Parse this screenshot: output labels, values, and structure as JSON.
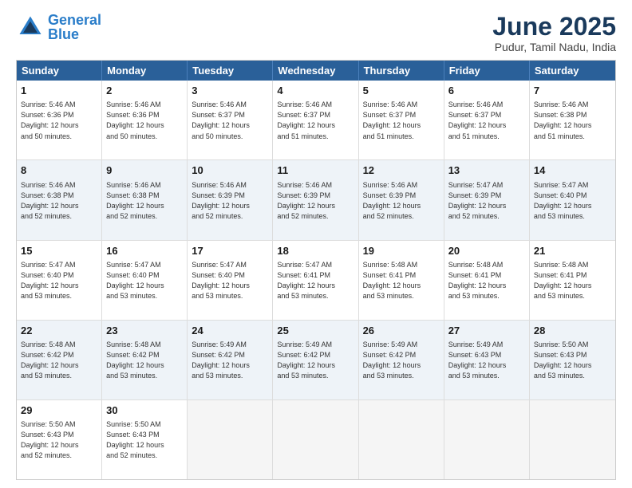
{
  "header": {
    "logo_general": "General",
    "logo_blue": "Blue",
    "month_title": "June 2025",
    "location": "Pudur, Tamil Nadu, India"
  },
  "calendar": {
    "days": [
      "Sunday",
      "Monday",
      "Tuesday",
      "Wednesday",
      "Thursday",
      "Friday",
      "Saturday"
    ],
    "rows": [
      [
        {
          "day": "1",
          "info": "Sunrise: 5:46 AM\nSunset: 6:36 PM\nDaylight: 12 hours\nand 50 minutes."
        },
        {
          "day": "2",
          "info": "Sunrise: 5:46 AM\nSunset: 6:36 PM\nDaylight: 12 hours\nand 50 minutes."
        },
        {
          "day": "3",
          "info": "Sunrise: 5:46 AM\nSunset: 6:37 PM\nDaylight: 12 hours\nand 50 minutes."
        },
        {
          "day": "4",
          "info": "Sunrise: 5:46 AM\nSunset: 6:37 PM\nDaylight: 12 hours\nand 51 minutes."
        },
        {
          "day": "5",
          "info": "Sunrise: 5:46 AM\nSunset: 6:37 PM\nDaylight: 12 hours\nand 51 minutes."
        },
        {
          "day": "6",
          "info": "Sunrise: 5:46 AM\nSunset: 6:37 PM\nDaylight: 12 hours\nand 51 minutes."
        },
        {
          "day": "7",
          "info": "Sunrise: 5:46 AM\nSunset: 6:38 PM\nDaylight: 12 hours\nand 51 minutes."
        }
      ],
      [
        {
          "day": "8",
          "info": "Sunrise: 5:46 AM\nSunset: 6:38 PM\nDaylight: 12 hours\nand 52 minutes."
        },
        {
          "day": "9",
          "info": "Sunrise: 5:46 AM\nSunset: 6:38 PM\nDaylight: 12 hours\nand 52 minutes."
        },
        {
          "day": "10",
          "info": "Sunrise: 5:46 AM\nSunset: 6:39 PM\nDaylight: 12 hours\nand 52 minutes."
        },
        {
          "day": "11",
          "info": "Sunrise: 5:46 AM\nSunset: 6:39 PM\nDaylight: 12 hours\nand 52 minutes."
        },
        {
          "day": "12",
          "info": "Sunrise: 5:46 AM\nSunset: 6:39 PM\nDaylight: 12 hours\nand 52 minutes."
        },
        {
          "day": "13",
          "info": "Sunrise: 5:47 AM\nSunset: 6:39 PM\nDaylight: 12 hours\nand 52 minutes."
        },
        {
          "day": "14",
          "info": "Sunrise: 5:47 AM\nSunset: 6:40 PM\nDaylight: 12 hours\nand 53 minutes."
        }
      ],
      [
        {
          "day": "15",
          "info": "Sunrise: 5:47 AM\nSunset: 6:40 PM\nDaylight: 12 hours\nand 53 minutes."
        },
        {
          "day": "16",
          "info": "Sunrise: 5:47 AM\nSunset: 6:40 PM\nDaylight: 12 hours\nand 53 minutes."
        },
        {
          "day": "17",
          "info": "Sunrise: 5:47 AM\nSunset: 6:40 PM\nDaylight: 12 hours\nand 53 minutes."
        },
        {
          "day": "18",
          "info": "Sunrise: 5:47 AM\nSunset: 6:41 PM\nDaylight: 12 hours\nand 53 minutes."
        },
        {
          "day": "19",
          "info": "Sunrise: 5:48 AM\nSunset: 6:41 PM\nDaylight: 12 hours\nand 53 minutes."
        },
        {
          "day": "20",
          "info": "Sunrise: 5:48 AM\nSunset: 6:41 PM\nDaylight: 12 hours\nand 53 minutes."
        },
        {
          "day": "21",
          "info": "Sunrise: 5:48 AM\nSunset: 6:41 PM\nDaylight: 12 hours\nand 53 minutes."
        }
      ],
      [
        {
          "day": "22",
          "info": "Sunrise: 5:48 AM\nSunset: 6:42 PM\nDaylight: 12 hours\nand 53 minutes."
        },
        {
          "day": "23",
          "info": "Sunrise: 5:48 AM\nSunset: 6:42 PM\nDaylight: 12 hours\nand 53 minutes."
        },
        {
          "day": "24",
          "info": "Sunrise: 5:49 AM\nSunset: 6:42 PM\nDaylight: 12 hours\nand 53 minutes."
        },
        {
          "day": "25",
          "info": "Sunrise: 5:49 AM\nSunset: 6:42 PM\nDaylight: 12 hours\nand 53 minutes."
        },
        {
          "day": "26",
          "info": "Sunrise: 5:49 AM\nSunset: 6:42 PM\nDaylight: 12 hours\nand 53 minutes."
        },
        {
          "day": "27",
          "info": "Sunrise: 5:49 AM\nSunset: 6:43 PM\nDaylight: 12 hours\nand 53 minutes."
        },
        {
          "day": "28",
          "info": "Sunrise: 5:50 AM\nSunset: 6:43 PM\nDaylight: 12 hours\nand 53 minutes."
        }
      ],
      [
        {
          "day": "29",
          "info": "Sunrise: 5:50 AM\nSunset: 6:43 PM\nDaylight: 12 hours\nand 52 minutes."
        },
        {
          "day": "30",
          "info": "Sunrise: 5:50 AM\nSunset: 6:43 PM\nDaylight: 12 hours\nand 52 minutes."
        },
        {
          "day": "",
          "empty": true
        },
        {
          "day": "",
          "empty": true
        },
        {
          "day": "",
          "empty": true
        },
        {
          "day": "",
          "empty": true
        },
        {
          "day": "",
          "empty": true
        }
      ]
    ]
  }
}
